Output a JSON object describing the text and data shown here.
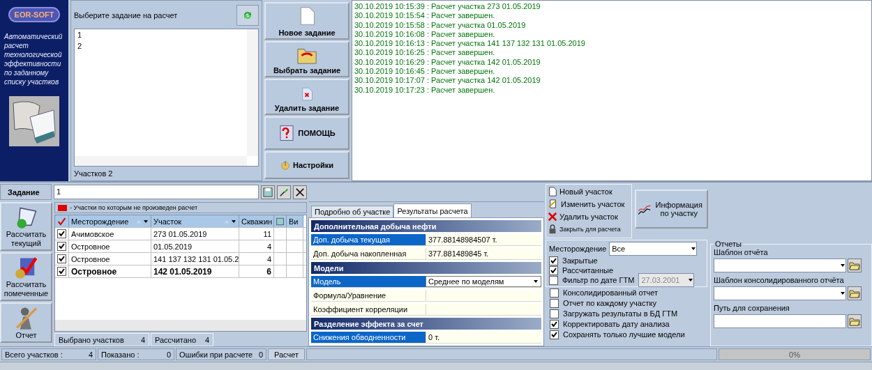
{
  "brand": {
    "logo": "EOR-SOFT",
    "description": "Автоматический расчет технологической эффективности по заданному списку участков"
  },
  "task_panel": {
    "title": "Выберите задание на расчет",
    "items": [
      "1",
      "2"
    ],
    "count": "Участков  2"
  },
  "main_buttons": [
    {
      "label": "Новое задание",
      "kind": "new"
    },
    {
      "label": "Выбрать задание",
      "kind": "open"
    },
    {
      "label": "Удалить задание",
      "kind": "delete"
    },
    {
      "label": "ПОМОЩЬ",
      "kind": "help"
    },
    {
      "label": "Настройки",
      "kind": "settings"
    }
  ],
  "log": [
    "30.10.2019 10:15:39 : Расчет участка 273 01.05.2019",
    "30.10.2019 10:15:54 : Расчет завершен.",
    "30.10.2019 10:15:58 : Расчет участка  01.05.2019",
    "30.10.2019 10:16:08 : Расчет завершен.",
    "30.10.2019 10:16:13 : Расчет участка 141 137 132 131  01.05.2019",
    "30.10.2019 10:16:25 : Расчет завершен.",
    "30.10.2019 10:16:29 : Расчет участка 142  01.05.2019",
    "30.10.2019 10:16:45 : Расчет завершен.",
    "30.10.2019 10:17:07 : Расчет участка 142  01.05.2019",
    "30.10.2019 10:17:23 : Расчет завершен."
  ],
  "task_field": {
    "label": "Задание",
    "value": "1"
  },
  "side_buttons": [
    {
      "label": "Рассчитать текущий",
      "kind": "calc"
    },
    {
      "label": "Рассчитать помеченные",
      "kind": "calc_marked"
    },
    {
      "label": "Отчет",
      "kind": "report"
    }
  ],
  "legend": "- Участки по которым не произведен расчет",
  "grid": {
    "columns": [
      "Месторождение",
      "Участок",
      "Скважин",
      "Ви"
    ],
    "rows": [
      {
        "checked": true,
        "field": "Ачимовское",
        "section": "273 01.05.2019",
        "wells": "11",
        "current": false
      },
      {
        "checked": true,
        "field": "Островное",
        "section": " 01.05.2019",
        "wells": "4",
        "current": false
      },
      {
        "checked": true,
        "field": "Островное",
        "section": "141 137 132 131  01.05.2",
        "wells": "4",
        "current": false
      },
      {
        "checked": true,
        "field": "Островное",
        "section": "142  01.05.2019",
        "wells": "6",
        "current": true
      }
    ],
    "footer": [
      {
        "label": "Выбрано участков",
        "value": "4"
      },
      {
        "label": "Рассчитано",
        "value": "4"
      }
    ]
  },
  "tabs": [
    {
      "label": "Подробно об участке",
      "selected": false
    },
    {
      "label": "Результаты расчета",
      "selected": true
    }
  ],
  "results": [
    {
      "title": "Дополнительная добыча нефти",
      "rows": [
        {
          "label": "Доп. добыча текущая",
          "value": "377.88148984507 т.",
          "selected": true,
          "kind": "text"
        },
        {
          "label": "Доп. добыча накопленная",
          "value": "377.881489845 т.",
          "selected": false,
          "kind": "text"
        }
      ]
    },
    {
      "title": "Модели",
      "rows": [
        {
          "label": "Модель",
          "value": "Среднее по моделям",
          "selected": true,
          "kind": "dropdown"
        },
        {
          "label": "Формула/Уравнение",
          "selected": false,
          "kind": "text"
        },
        {
          "label": "Коэффициент корреляции",
          "selected": false,
          "kind": "text"
        }
      ]
    },
    {
      "title": "Разделение эффекта за счет",
      "rows": [
        {
          "label": "Снижения обводненности",
          "value": "0 т.",
          "selected": true,
          "kind": "text"
        }
      ]
    }
  ],
  "actions": [
    {
      "label": "Новый участок",
      "kind": "new"
    },
    {
      "label": "Изменить участок",
      "kind": "edit"
    },
    {
      "label": "Удалить участок",
      "kind": "delete"
    },
    {
      "label": "Закрыть для расчета",
      "kind": "lock"
    }
  ],
  "info_button": "Информация по участку",
  "filter": {
    "label": "Месторождение",
    "value": "Все",
    "checks": [
      {
        "label": "Закрытые",
        "checked": true
      },
      {
        "label": "Рассчитанные",
        "checked": true
      },
      {
        "label": "Фильтр по дате ГТМ",
        "checked": false,
        "date": "27.03.2001"
      }
    ]
  },
  "options": [
    {
      "label": "Консолидированный отчет",
      "checked": false
    },
    {
      "label": "Отчет по каждому участку",
      "checked": false
    },
    {
      "label": "Загружать результаты в БД ГТМ",
      "checked": false
    },
    {
      "label": "Корректировать дату анализа",
      "checked": true
    },
    {
      "label": "Сохранять только лучшие модели",
      "checked": true
    }
  ],
  "reports": {
    "title": "Отчеты",
    "fields": [
      {
        "label": "Шаблон отчёта",
        "kind": "combo"
      },
      {
        "label": "Шаблон консолидированного отчёта",
        "kind": "combo"
      },
      {
        "label": "Путь для сохранения",
        "kind": "path"
      }
    ]
  },
  "status": {
    "cells": [
      {
        "label": "Всего участков :",
        "value": "4"
      },
      {
        "label": "Показано :",
        "value": "0"
      },
      {
        "label": "Ошибки при расчете",
        "value": "0"
      }
    ],
    "button": "Расчет",
    "progress": {
      "level": 0,
      "text": "0%"
    }
  }
}
